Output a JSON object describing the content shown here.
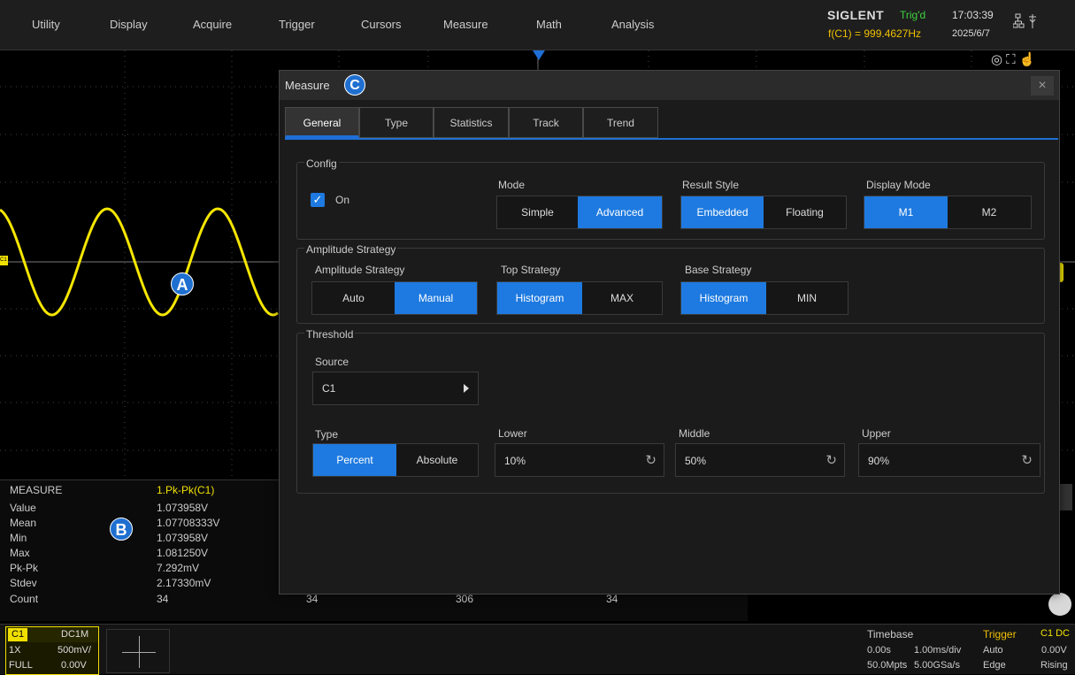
{
  "menu": [
    "Utility",
    "Display",
    "Acquire",
    "Trigger",
    "Cursors",
    "Measure",
    "Math",
    "Analysis"
  ],
  "status": {
    "brand": "SIGLENT",
    "trig_state": "Trig'd",
    "frequency": "f(C1) = 999.4627Hz",
    "time": "17:03:39",
    "date": "2025/6/7"
  },
  "markers": {
    "a": "A",
    "b": "B",
    "c": "C"
  },
  "channel_tag": "C1",
  "measure_panel": {
    "header_label": "MEASURE",
    "header_value": "1.Pk-Pk(C1)",
    "rows": [
      {
        "label": "Value",
        "value": "1.073958V"
      },
      {
        "label": "Mean",
        "value": "1.07708333V"
      },
      {
        "label": "Min",
        "value": "1.073958V"
      },
      {
        "label": "Max",
        "value": "1.081250V"
      },
      {
        "label": "Pk-Pk",
        "value": "7.292mV"
      },
      {
        "label": "Stdev",
        "value": "2.17330mV"
      },
      {
        "label": "Count",
        "value": "34",
        "v2": "34",
        "v3": "306",
        "v4": "34"
      }
    ]
  },
  "dialog": {
    "title": "Measure",
    "close": "×",
    "tabs": [
      "General",
      "Type",
      "Statistics",
      "Track",
      "Trend"
    ],
    "config": {
      "title": "Config",
      "on_label": "On",
      "check": "✓",
      "mode_label": "Mode",
      "mode_options": [
        "Simple",
        "Advanced"
      ],
      "result_style_label": "Result Style",
      "result_style_options": [
        "Embedded",
        "Floating"
      ],
      "display_mode_label": "Display Mode",
      "display_mode_options": [
        "M1",
        "M2"
      ]
    },
    "amplitude": {
      "title": "Amplitude Strategy",
      "amp_label": "Amplitude Strategy",
      "amp_options": [
        "Auto",
        "Manual"
      ],
      "top_label": "Top Strategy",
      "top_options": [
        "Histogram",
        "MAX"
      ],
      "base_label": "Base Strategy",
      "base_options": [
        "Histogram",
        "MIN"
      ]
    },
    "threshold": {
      "title": "Threshold",
      "source_label": "Source",
      "source_value": "C1",
      "type_label": "Type",
      "type_options": [
        "Percent",
        "Absolute"
      ],
      "lower_label": "Lower",
      "lower_value": "10%",
      "middle_label": "Middle",
      "middle_value": "50%",
      "upper_label": "Upper",
      "upper_value": "90%"
    }
  },
  "bottom": {
    "ch1": {
      "tag": "C1",
      "coupling": "DC1M",
      "probe": "1X",
      "scale": "500mV/",
      "bw": "FULL",
      "offset": "0.00V"
    },
    "timebase": {
      "title": "Timebase",
      "delay": "0.00s",
      "scale": "1.00ms/div",
      "memory": "50.0Mpts",
      "rate": "5.00GSa/s"
    },
    "trigger": {
      "title": "Trigger",
      "mode": "Auto",
      "type": "Edge",
      "source": "C1 DC",
      "level": "0.00V",
      "slope": "Rising"
    }
  },
  "colors": {
    "accent": "#1e7ae0",
    "ch1": "#f0e000",
    "trig_ok": "#3fd33f"
  }
}
